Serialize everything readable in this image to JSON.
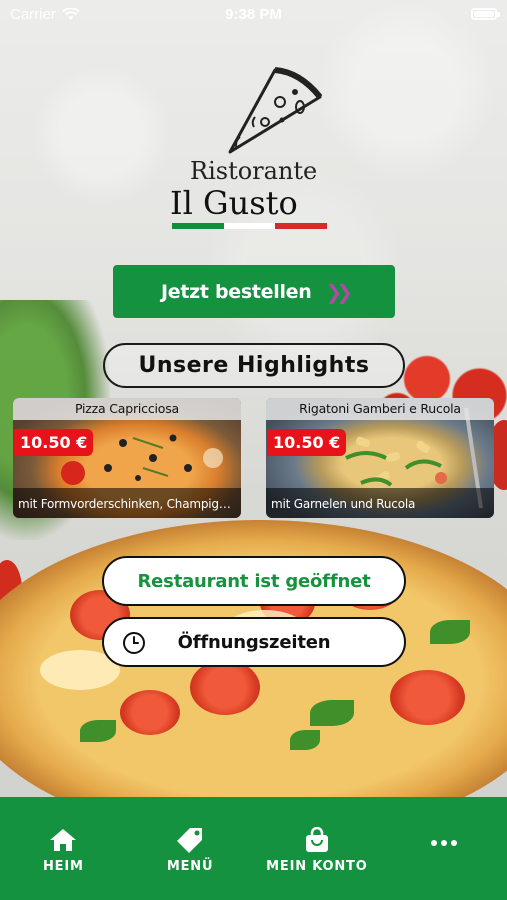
{
  "status_bar": {
    "carrier": "Carrier",
    "time": "9:38 PM"
  },
  "logo": {
    "line1": "Ristorante",
    "line2": "Il Gusto",
    "flag_colors": [
      "#0d8f3c",
      "#ffffff",
      "#d42b2b"
    ]
  },
  "order_button": {
    "label": "Jetzt bestellen",
    "arrow_color": "#b14aa4"
  },
  "highlights": {
    "title": "Unsere Highlights",
    "items": [
      {
        "name": "Pizza Capricciosa",
        "price": "10.50 €",
        "description": "mit Formvorderschinken, Champignons,..."
      },
      {
        "name": "Rigatoni Gamberi e Rucola",
        "price": "10.50 €",
        "description": "mit Garnelen und Rucola"
      }
    ]
  },
  "status_pill": {
    "label": "Restaurant ist geöffnet"
  },
  "hours_pill": {
    "label": "Öffnungszeiten"
  },
  "tabs": [
    {
      "label": "HEIM",
      "icon": "home-icon"
    },
    {
      "label": "MENÜ",
      "icon": "tag-icon"
    },
    {
      "label": "MEIN KONTO",
      "icon": "shopping-bag-icon"
    },
    {
      "label": "",
      "icon": "more-icon"
    }
  ],
  "colors": {
    "brand_green": "#14923f",
    "price_red": "#e8131a",
    "open_text": "#17923f"
  }
}
